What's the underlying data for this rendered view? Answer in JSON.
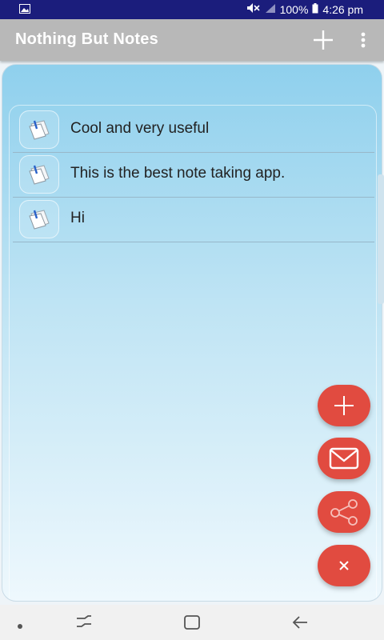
{
  "status_bar": {
    "battery": "100%",
    "time": "4:26 pm"
  },
  "app_bar": {
    "title": "Nothing But Notes"
  },
  "notes": [
    {
      "text": "Cool and very useful"
    },
    {
      "text": "This is the best note taking app."
    },
    {
      "text": "Hi"
    }
  ],
  "colors": {
    "status_bar": "#1b1d7c",
    "app_bar": "#b8b8b8",
    "fab": "#e14b40"
  },
  "fabs": [
    {
      "icon": "plus-icon"
    },
    {
      "icon": "mail-icon"
    },
    {
      "icon": "share-icon"
    },
    {
      "icon": "close-icon"
    }
  ]
}
